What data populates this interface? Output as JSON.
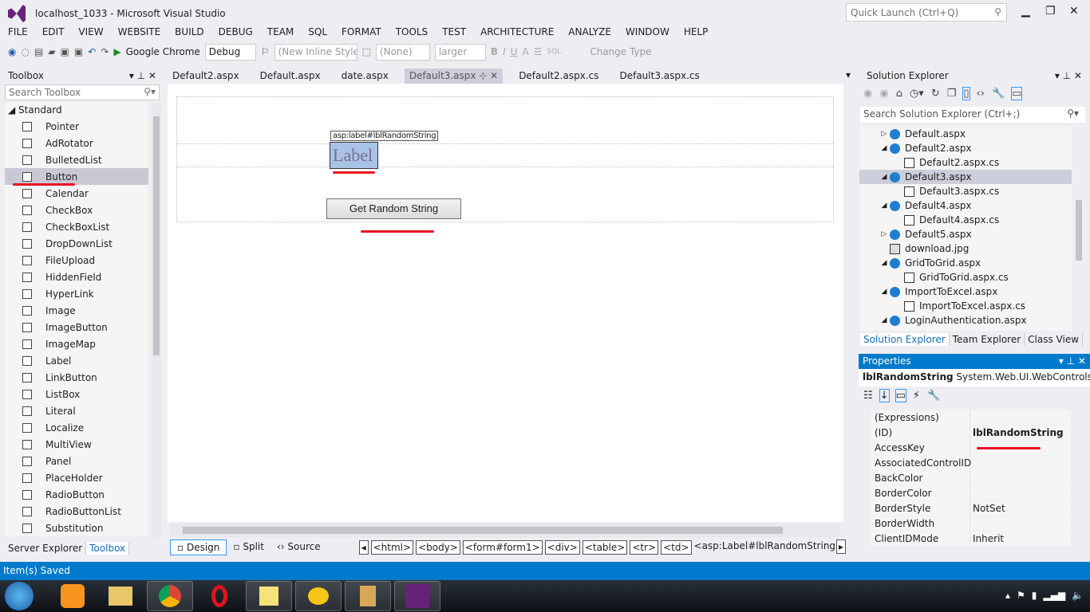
{
  "window": {
    "title": "localhost_1033 - Microsoft Visual Studio",
    "quick_launch_placeholder": "Quick Launch (Ctrl+Q)"
  },
  "menu": [
    "FILE",
    "EDIT",
    "VIEW",
    "WEBSITE",
    "BUILD",
    "DEBUG",
    "TEAM",
    "SQL",
    "FORMAT",
    "TOOLS",
    "TEST",
    "ARCHITECTURE",
    "ANALYZE",
    "WINDOW",
    "HELP"
  ],
  "toolbar": {
    "browser": "Google Chrome",
    "config": "Debug",
    "style": "(New Inline Style",
    "target": "(None)",
    "font_size": "larger",
    "bold": "B",
    "italic": "I",
    "underline": "U",
    "change_type": "Change Type"
  },
  "toolbox": {
    "title": "Toolbox",
    "search_placeholder": "Search Toolbox",
    "group": "Standard",
    "items": [
      "Pointer",
      "AdRotator",
      "BulletedList",
      "Button",
      "Calendar",
      "CheckBox",
      "CheckBoxList",
      "DropDownList",
      "FileUpload",
      "HiddenField",
      "HyperLink",
      "Image",
      "ImageButton",
      "ImageMap",
      "Label",
      "LinkButton",
      "ListBox",
      "Literal",
      "Localize",
      "MultiView",
      "Panel",
      "PlaceHolder",
      "RadioButton",
      "RadioButtonList",
      "Substitution"
    ],
    "selected": "Button",
    "tabs": [
      "Server Explorer",
      "Toolbox"
    ]
  },
  "doc_tabs": [
    "Default2.aspx",
    "Default.aspx",
    "date.aspx",
    "Default3.aspx",
    "Default2.aspx.cs",
    "Default3.aspx.cs"
  ],
  "active_tab": "Default3.aspx",
  "design": {
    "label_tag": "asp:label#lblRandomString",
    "label_text": "Label",
    "button_text": "Get Random String"
  },
  "views": {
    "design": "Design",
    "split": "Split",
    "source": "Source"
  },
  "breadcrumbs": [
    "<html>",
    "<body>",
    "<form#form1>",
    "<div>",
    "<table>",
    "<tr>",
    "<td>",
    "<asp:Label#lblRandomString>"
  ],
  "solution_explorer": {
    "title": "Solution Explorer",
    "search_placeholder": "Search Solution Explorer (Ctrl+;)",
    "nodes": [
      {
        "name": "Default.aspx",
        "type": "aspx",
        "expand": "collapsed",
        "indent": 0
      },
      {
        "name": "Default2.aspx",
        "type": "aspx",
        "expand": "expanded",
        "indent": 0
      },
      {
        "name": "Default2.aspx.cs",
        "type": "cs",
        "expand": "none",
        "indent": 1
      },
      {
        "name": "Default3.aspx",
        "type": "aspx",
        "expand": "expanded",
        "indent": 0,
        "selected": true
      },
      {
        "name": "Default3.aspx.cs",
        "type": "cs",
        "expand": "none",
        "indent": 1
      },
      {
        "name": "Default4.aspx",
        "type": "aspx",
        "expand": "expanded",
        "indent": 0
      },
      {
        "name": "Default4.aspx.cs",
        "type": "cs",
        "expand": "none",
        "indent": 1
      },
      {
        "name": "Default5.aspx",
        "type": "aspx",
        "expand": "collapsed",
        "indent": 0
      },
      {
        "name": "download.jpg",
        "type": "img",
        "expand": "none",
        "indent": 0
      },
      {
        "name": "GridToGrid.aspx",
        "type": "aspx",
        "expand": "expanded",
        "indent": 0
      },
      {
        "name": "GridToGrid.aspx.cs",
        "type": "cs",
        "expand": "none",
        "indent": 1
      },
      {
        "name": "ImportToExcel.aspx",
        "type": "aspx",
        "expand": "expanded",
        "indent": 0
      },
      {
        "name": "ImportToExcel.aspx.cs",
        "type": "cs",
        "expand": "none",
        "indent": 1
      },
      {
        "name": "LoginAuthentication.aspx",
        "type": "aspx",
        "expand": "expanded",
        "indent": 0
      }
    ],
    "tabs": [
      "Solution Explorer",
      "Team Explorer",
      "Class View"
    ]
  },
  "properties": {
    "title": "Properties",
    "object_name": "lblRandomString",
    "object_type": "System.Web.UI.WebControls.La",
    "rows": [
      [
        "(Expressions)",
        ""
      ],
      [
        "(ID)",
        "lblRandomString"
      ],
      [
        "AccessKey",
        ""
      ],
      [
        "AssociatedControlID",
        ""
      ],
      [
        "BackColor",
        ""
      ],
      [
        "BorderColor",
        ""
      ],
      [
        "BorderStyle",
        "NotSet"
      ],
      [
        "BorderWidth",
        ""
      ],
      [
        "ClientIDMode",
        "Inherit"
      ]
    ]
  },
  "status": "Item(s) Saved",
  "colors": {
    "accent": "#007acc",
    "annotation": "#e81123",
    "vs_purple": "#68217a"
  }
}
